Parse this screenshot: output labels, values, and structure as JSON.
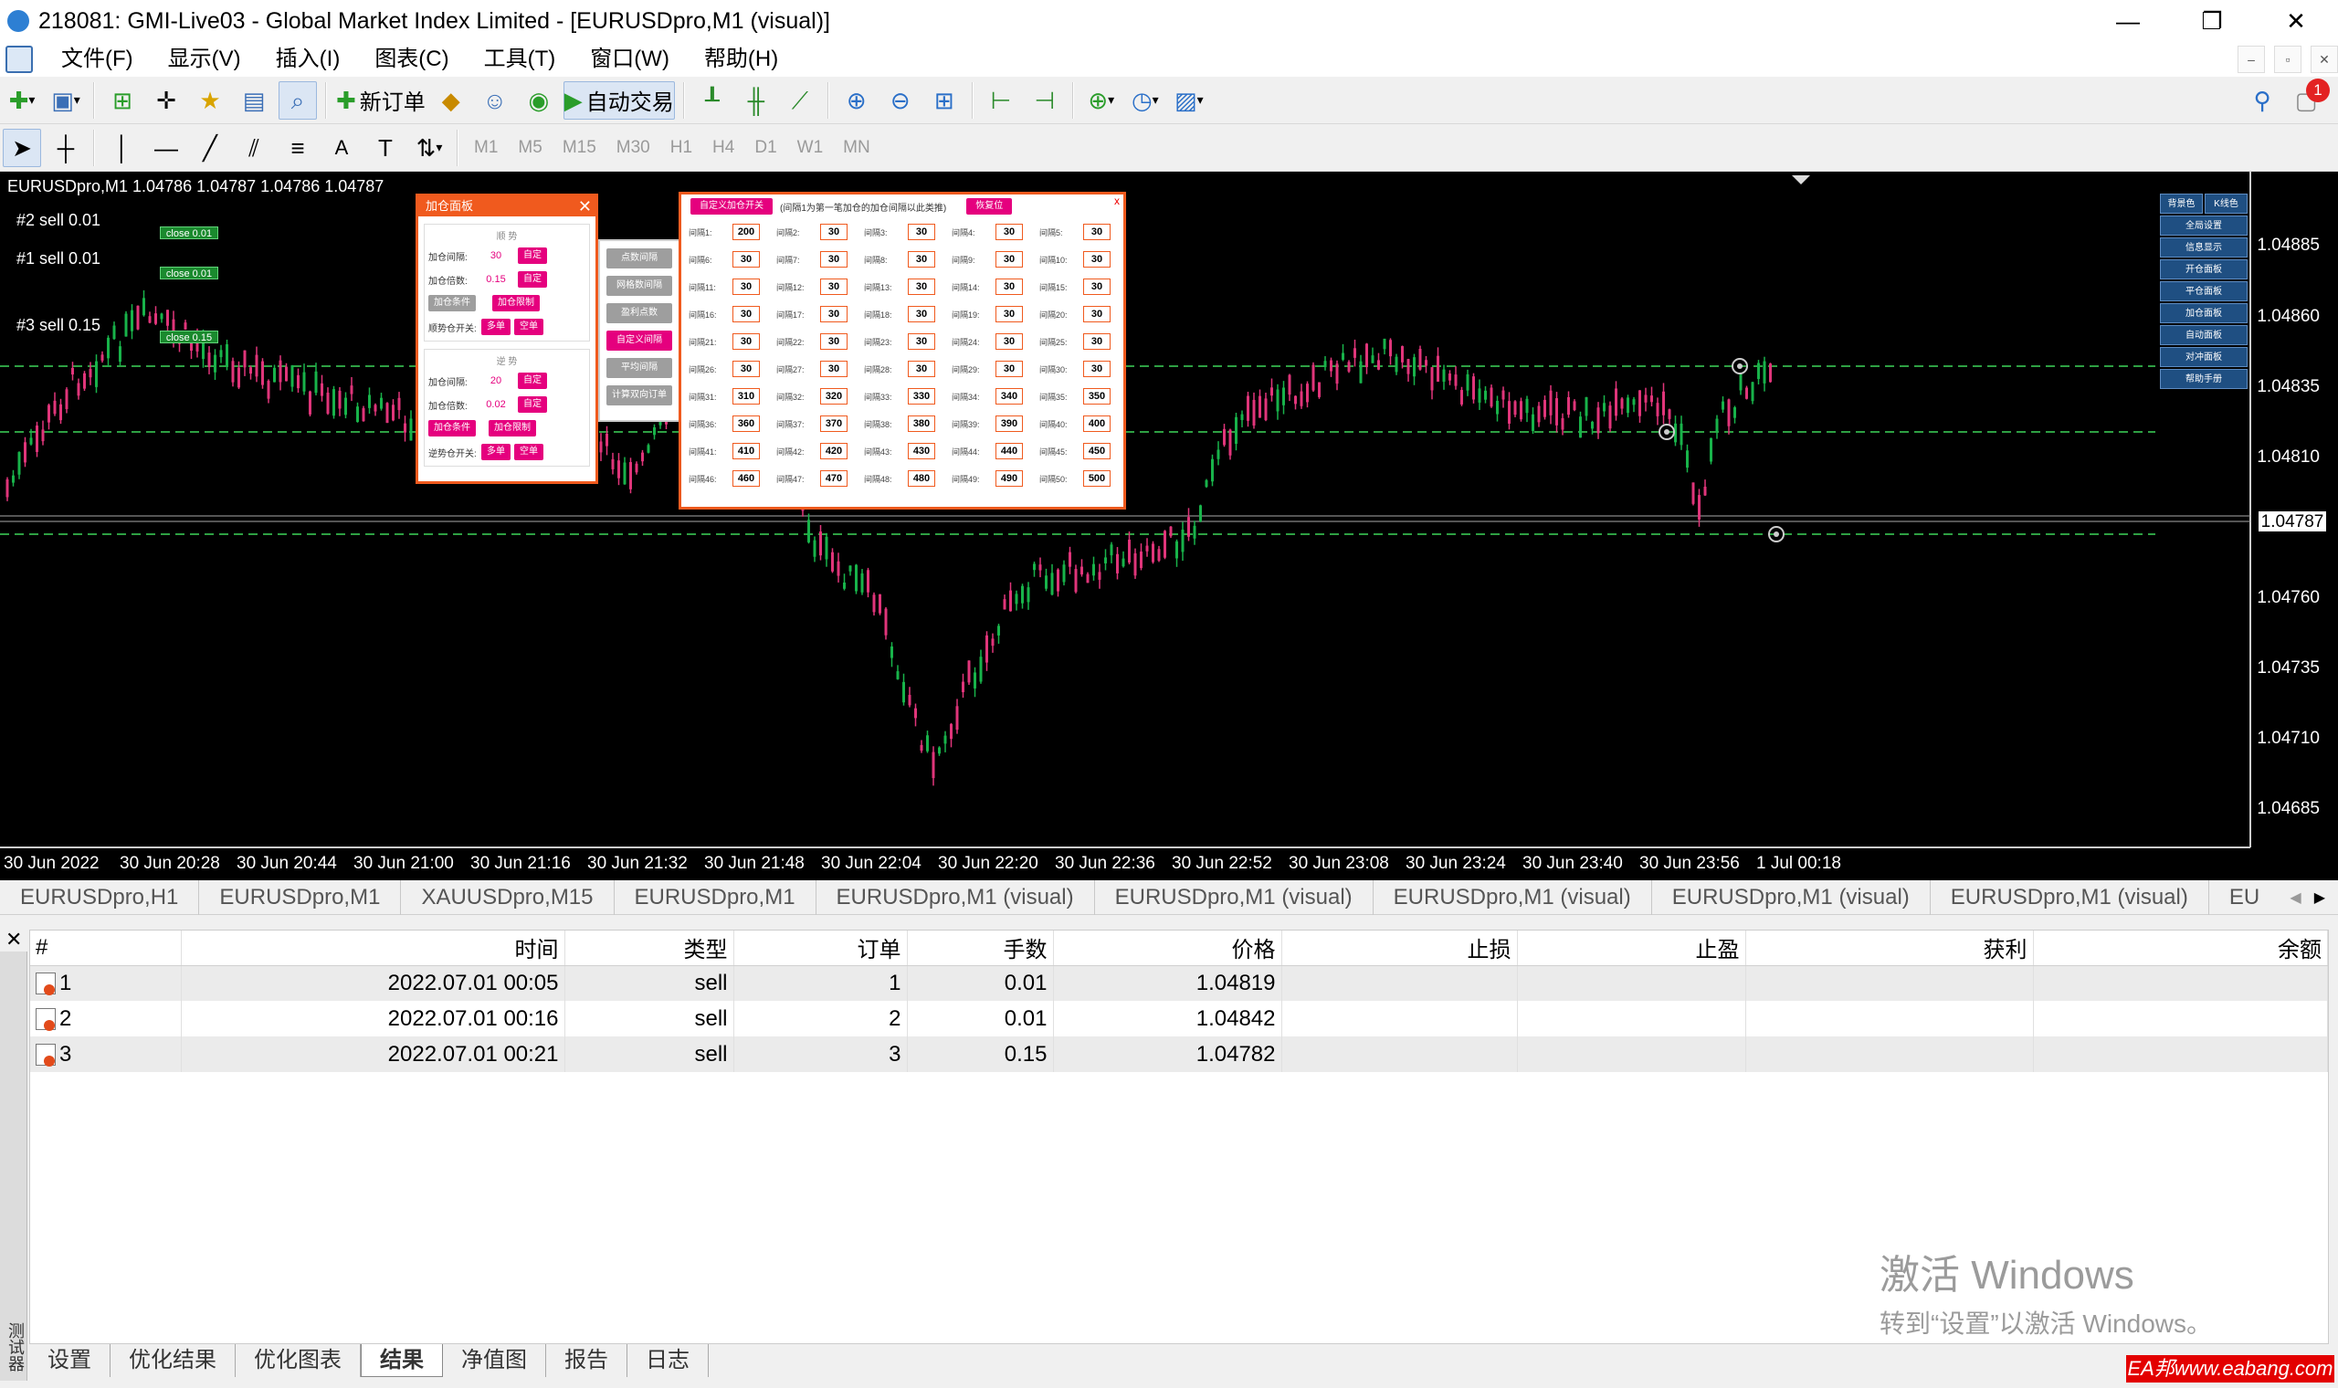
{
  "window": {
    "title": "218081: GMI-Live03 - Global Market Index Limited - [EURUSDpro,M1 (visual)]",
    "min": "—",
    "restore": "❐",
    "close": "✕"
  },
  "menu": [
    "文件(F)",
    "显示(V)",
    "插入(I)",
    "图表(C)",
    "工具(T)",
    "窗口(W)",
    "帮助(H)"
  ],
  "toolbar": {
    "new_order": "新订单",
    "auto_trade": "自动交易",
    "notifications_count": "1"
  },
  "timeframes": [
    "M1",
    "M5",
    "M15",
    "M30",
    "H1",
    "H4",
    "D1",
    "W1",
    "MN"
  ],
  "chart": {
    "symbol_info": "EURUSDpro,M1  1.04786 1.04787 1.04786 1.04787",
    "current_price": "1.04787",
    "price_labels": [
      "1.04885",
      "1.04860",
      "1.04835",
      "1.04810",
      "1.04760",
      "1.04735",
      "1.04710",
      "1.04685"
    ],
    "time_labels": [
      "30 Jun 2022",
      "30 Jun 20:28",
      "30 Jun 20:44",
      "30 Jun 21:00",
      "30 Jun 21:16",
      "30 Jun 21:32",
      "30 Jun 21:48",
      "30 Jun 22:04",
      "30 Jun 22:20",
      "30 Jun 22:36",
      "30 Jun 22:52",
      "30 Jun 23:08",
      "30 Jun 23:24",
      "30 Jun 23:40",
      "30 Jun 23:56",
      "1 Jul 00:18"
    ],
    "orders": [
      {
        "label": "#2 sell 0.01",
        "close": "close 0.01"
      },
      {
        "label": "#1 sell 0.01",
        "close": "close 0.01"
      },
      {
        "label": "#3 sell 0.15",
        "close": "close 0.15"
      }
    ]
  },
  "panel_add": {
    "title": "加仓面板",
    "sec1": {
      "title": "顺 势",
      "row1": {
        "label": "加仓间隔:",
        "value": "30",
        "btn": "自定"
      },
      "row2": {
        "label": "加仓倍数:",
        "value": "0.15",
        "btn": "自定"
      },
      "row3": {
        "btn1": "加仓条件",
        "btn2": "加仓限制"
      },
      "row4": {
        "label": "顺势仓开关:",
        "btn1": "多单",
        "btn2": "空单"
      }
    },
    "sec2": {
      "title": "逆 势",
      "row1": {
        "label": "加仓间隔:",
        "value": "20",
        "btn": "自定"
      },
      "row2": {
        "label": "加仓倍数:",
        "value": "0.02",
        "btn": "自定"
      },
      "row3": {
        "btn1": "加仓条件",
        "btn2": "加仓限制"
      },
      "row4": {
        "label": "逆势仓开关:",
        "btn1": "多单",
        "btn2": "空单"
      }
    }
  },
  "panel_mid": [
    "点数间隔",
    "网格数间隔",
    "盈利点数",
    "自定义间隔",
    "平均间隔",
    "计算双向订单"
  ],
  "panel_custom": {
    "toggle": "自定义加仓开关",
    "note": "(间隔1为第一笔加仓的加仓间隔以此类推)",
    "reset": "恢复位",
    "close": "x",
    "intervals": [
      {
        "n": "间隔1:",
        "v": "200"
      },
      {
        "n": "间隔2:",
        "v": "30"
      },
      {
        "n": "间隔3:",
        "v": "30"
      },
      {
        "n": "间隔4:",
        "v": "30"
      },
      {
        "n": "间隔5:",
        "v": "30"
      },
      {
        "n": "间隔6:",
        "v": "30"
      },
      {
        "n": "间隔7:",
        "v": "30"
      },
      {
        "n": "间隔8:",
        "v": "30"
      },
      {
        "n": "间隔9:",
        "v": "30"
      },
      {
        "n": "间隔10:",
        "v": "30"
      },
      {
        "n": "间隔11:",
        "v": "30"
      },
      {
        "n": "间隔12:",
        "v": "30"
      },
      {
        "n": "间隔13:",
        "v": "30"
      },
      {
        "n": "间隔14:",
        "v": "30"
      },
      {
        "n": "间隔15:",
        "v": "30"
      },
      {
        "n": "间隔16:",
        "v": "30"
      },
      {
        "n": "间隔17:",
        "v": "30"
      },
      {
        "n": "间隔18:",
        "v": "30"
      },
      {
        "n": "间隔19:",
        "v": "30"
      },
      {
        "n": "间隔20:",
        "v": "30"
      },
      {
        "n": "间隔21:",
        "v": "30"
      },
      {
        "n": "间隔22:",
        "v": "30"
      },
      {
        "n": "间隔23:",
        "v": "30"
      },
      {
        "n": "间隔24:",
        "v": "30"
      },
      {
        "n": "间隔25:",
        "v": "30"
      },
      {
        "n": "间隔26:",
        "v": "30"
      },
      {
        "n": "间隔27:",
        "v": "30"
      },
      {
        "n": "间隔28:",
        "v": "30"
      },
      {
        "n": "间隔29:",
        "v": "30"
      },
      {
        "n": "间隔30:",
        "v": "30"
      },
      {
        "n": "间隔31:",
        "v": "310"
      },
      {
        "n": "间隔32:",
        "v": "320"
      },
      {
        "n": "间隔33:",
        "v": "330"
      },
      {
        "n": "间隔34:",
        "v": "340"
      },
      {
        "n": "间隔35:",
        "v": "350"
      },
      {
        "n": "间隔36:",
        "v": "360"
      },
      {
        "n": "间隔37:",
        "v": "370"
      },
      {
        "n": "间隔38:",
        "v": "380"
      },
      {
        "n": "间隔39:",
        "v": "390"
      },
      {
        "n": "间隔40:",
        "v": "400"
      },
      {
        "n": "间隔41:",
        "v": "410"
      },
      {
        "n": "间隔42:",
        "v": "420"
      },
      {
        "n": "间隔43:",
        "v": "430"
      },
      {
        "n": "间隔44:",
        "v": "440"
      },
      {
        "n": "间隔45:",
        "v": "450"
      },
      {
        "n": "间隔46:",
        "v": "460"
      },
      {
        "n": "间隔47:",
        "v": "470"
      },
      {
        "n": "间隔48:",
        "v": "480"
      },
      {
        "n": "间隔49:",
        "v": "490"
      },
      {
        "n": "间隔50:",
        "v": "500"
      }
    ]
  },
  "right_menu": [
    "背景色",
    "K线色",
    "全局设置",
    "信息显示",
    "开仓面板",
    "平仓面板",
    "加仓面板",
    "自动面板",
    "对冲面板",
    "帮助手册"
  ],
  "chart_tabs": [
    "EURUSDpro,H1",
    "EURUSDpro,M1",
    "XAUUSDpro,M15",
    "EURUSDpro,M1",
    "EURUSDpro,M1 (visual)",
    "EURUSDpro,M1 (visual)",
    "EURUSDpro,M1 (visual)",
    "EURUSDpro,M1 (visual)",
    "EURUSDpro,M1 (visual)",
    "EU"
  ],
  "terminal": {
    "close": "✕",
    "side_label": "测试器",
    "columns": [
      "#",
      "时间",
      "类型",
      "订单",
      "手数",
      "价格",
      "止损",
      "止盈",
      "获利",
      "余额"
    ],
    "rows": [
      [
        "1",
        "2022.07.01 00:05",
        "sell",
        "1",
        "0.01",
        "1.04819",
        "",
        "",
        "",
        ""
      ],
      [
        "2",
        "2022.07.01 00:16",
        "sell",
        "2",
        "0.01",
        "1.04842",
        "",
        "",
        "",
        ""
      ],
      [
        "3",
        "2022.07.01 00:21",
        "sell",
        "3",
        "0.15",
        "1.04782",
        "",
        "",
        "",
        ""
      ]
    ],
    "tabs": [
      "设置",
      "优化结果",
      "优化图表",
      "结果",
      "净值图",
      "报告",
      "日志"
    ]
  },
  "watermark": {
    "line1": "激活 Windows",
    "line2": "转到“设置”以激活 Windows。"
  },
  "corner_badge": "EA邦www.eabang.com"
}
